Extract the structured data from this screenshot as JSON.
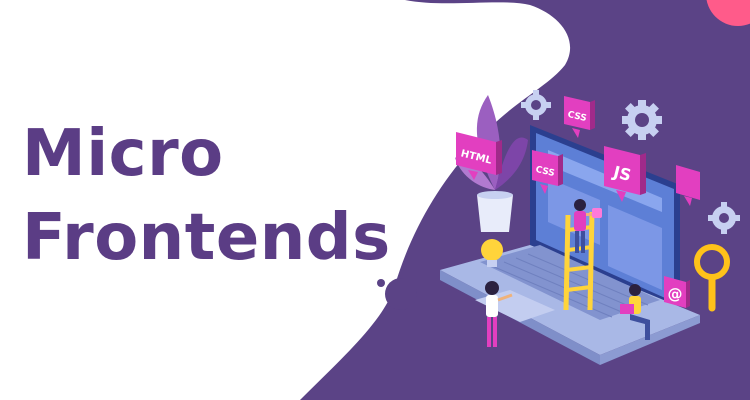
{
  "headline": {
    "line1": "Micro",
    "line2": "Frontends"
  },
  "badges": {
    "html": "HTML",
    "css_top": "CSS",
    "css_left": "CSS",
    "js": "JS",
    "at": "@"
  },
  "colors": {
    "title": "#5b3d85",
    "background_shape": "#5b4386",
    "badge_magenta": "#e23fc0",
    "laptop_frame": "#a9b8e6",
    "screen": "#5d7fd6",
    "ladder": "#ffd43b",
    "gear": "#c7d0f1",
    "accent_pink": "#ff5b8a",
    "magnifier": "#ffc21a"
  },
  "icons": [
    "gear-icon",
    "magnifier-icon",
    "lightbulb-icon",
    "speech-bubble-icon",
    "plant-icon"
  ]
}
